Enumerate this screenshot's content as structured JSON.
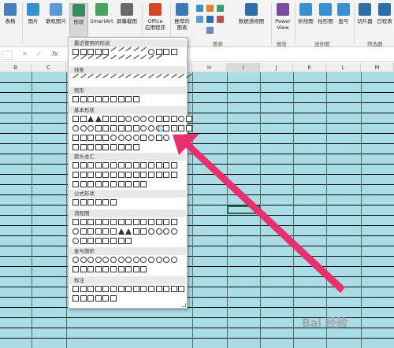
{
  "ribbon": {
    "buttons": [
      {
        "label": "表格",
        "color": "#4a7ebb"
      },
      {
        "label": "图片",
        "color": "#3a8fd1"
      },
      {
        "label": "联机图片",
        "color": "#5a9bd5"
      },
      {
        "label": "形状",
        "color": "#3b8a5a"
      },
      {
        "label": "SmartArt",
        "color": "#4aa35a"
      },
      {
        "label": "屏幕截图",
        "color": "#6a6a6a"
      },
      {
        "label": "Office\n应用程序",
        "color": "#d24726"
      },
      {
        "label": "推荐的\n图表",
        "color": "#3a7ab8"
      },
      {
        "label": "数据透视图",
        "color": "#2f6fa8"
      },
      {
        "label": "Power\nView",
        "color": "#7a4ba0"
      },
      {
        "label": "折线图",
        "color": "#3a8fd1"
      },
      {
        "label": "柱形图",
        "color": "#3a8fd1"
      },
      {
        "label": "盈亏",
        "color": "#3a8fd1"
      },
      {
        "label": "切片器",
        "color": "#2f6fa8"
      },
      {
        "label": "日程表",
        "color": "#2f6fa8"
      }
    ],
    "groups": [
      "图表",
      "报告",
      "迷你图",
      "筛选器"
    ]
  },
  "formula_bar": {
    "cancel": "✕",
    "confirm": "✓",
    "fx": "fx"
  },
  "columns": [
    "B",
    "C",
    "D",
    "E",
    "F",
    "G",
    "H",
    "I",
    "J",
    "K",
    "L",
    "M"
  ],
  "shapes_menu": {
    "sections": [
      "最近使用的形状",
      "线条",
      "矩形",
      "基本形状",
      "箭头总汇",
      "公式形状",
      "流程图",
      "星与旗帜",
      "标注"
    ]
  },
  "watermark": "Bai 经验",
  "colors": {
    "cell_fill": "#aadde6",
    "arrow": "#e8306f",
    "menu_header": "#e8e8e8"
  }
}
